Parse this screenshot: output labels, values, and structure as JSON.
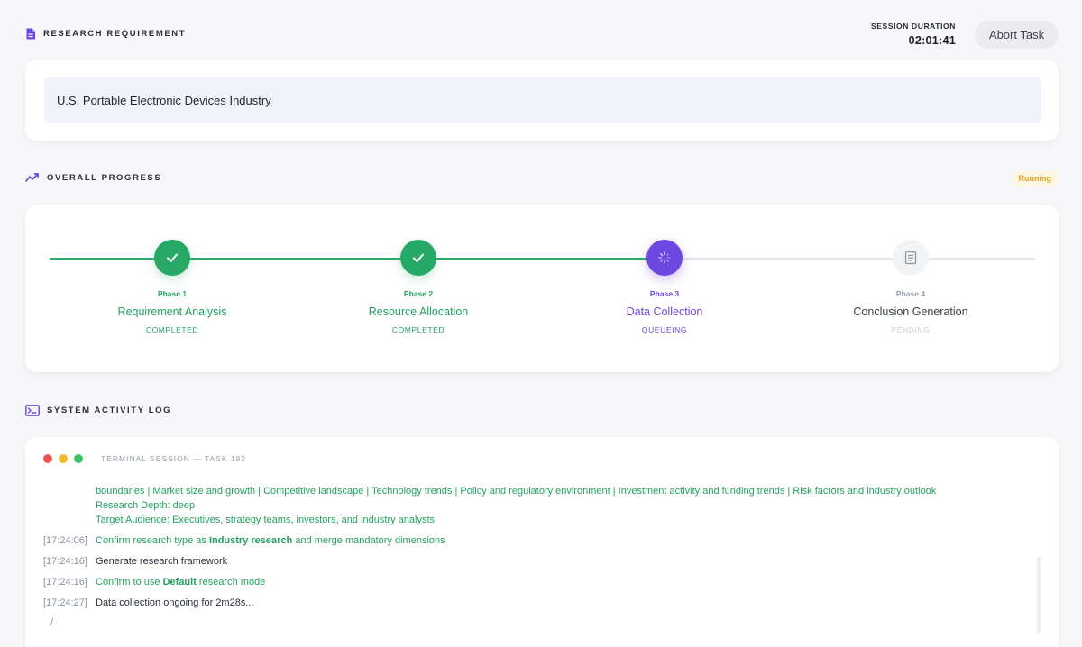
{
  "header": {
    "section_title": "RESEARCH REQUIREMENT",
    "session_label": "SESSION DURATION",
    "session_value": "02:01:41",
    "abort_label": "Abort Task"
  },
  "requirement": {
    "text": "U.S. Portable Electronic Devices Industry"
  },
  "progress": {
    "section_title": "OVERALL PROGRESS",
    "status": "Running",
    "phases": [
      {
        "number": "Phase 1",
        "name": "Requirement Analysis",
        "state": "COMPLETED"
      },
      {
        "number": "Phase 2",
        "name": "Resource Allocation",
        "state": "COMPLETED"
      },
      {
        "number": "Phase 3",
        "name": "Data Collection",
        "state": "QUEUEING"
      },
      {
        "number": "Phase 4",
        "name": "Conclusion Generation",
        "state": "PENDING"
      }
    ]
  },
  "activity": {
    "section_title": "SYSTEM ACTIVITY LOG",
    "terminal_title": "TERMINAL SESSION — TASK 182",
    "continuation": [
      "boundaries | Market size and growth | Competitive landscape | Technology trends | Policy and regulatory environment | Investment activity and funding trends | Risk factors and industry outlook",
      "Research Depth: deep",
      "Target Audience: Executives, strategy teams, investors, and industry analysts"
    ],
    "entries": [
      {
        "time": "[17:24:06]",
        "pre": "Confirm research type as ",
        "bold": "Industry research",
        "post": " and merge mandatory dimensions"
      },
      {
        "time": "[17:24:16]",
        "text": "Generate research framework"
      },
      {
        "time": "[17:24:16]",
        "pre": "Confirm to use ",
        "bold": "Default",
        "post": " research mode"
      },
      {
        "time": "[17:24:27]",
        "text": "Data collection ongoing for 2m28s..."
      }
    ],
    "cursor": "/"
  },
  "colors": {
    "accent_green": "#26a866",
    "accent_purple": "#6e46e0",
    "running_badge": "#e5a11a",
    "dot_red": "#ef5350",
    "dot_yellow": "#f5b82e",
    "dot_green": "#3cc163"
  },
  "icons": {
    "requirement": "document-icon",
    "progress": "trend-chart-icon",
    "activity": "terminal-icon",
    "phase_done": "check-icon",
    "phase_active": "spinner-icon",
    "phase_pending": "document-lines-icon"
  }
}
